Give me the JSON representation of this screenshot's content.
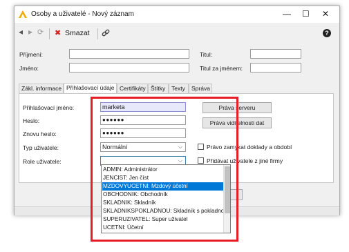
{
  "window": {
    "title": "Osoby a uživatelé - Nový záznam",
    "minimize": "—",
    "maximize": "☐",
    "close": "✕"
  },
  "toolbar": {
    "back_icon": "◂",
    "forward_icon": "▸",
    "refresh_icon": "⟳",
    "delete_icon": "✖",
    "delete_label": "Smazat",
    "link_icon": "🔗",
    "help_icon": "?"
  },
  "header_form": {
    "surname_label": "Příjmení:",
    "name_label": "Jméno:",
    "title_label": "Titul:",
    "title_after_label": "Titul za jménem:",
    "surname_value": "",
    "name_value": "",
    "title_value": "",
    "title_after_value": ""
  },
  "tabs": [
    {
      "label": "Zákl. informace",
      "active": false
    },
    {
      "label": "Přihlašovací údaje",
      "active": true
    },
    {
      "label": "Certifikáty",
      "active": false
    },
    {
      "label": "Štítky",
      "active": false
    },
    {
      "label": "Texty",
      "active": false
    },
    {
      "label": "Správa",
      "active": false
    }
  ],
  "login": {
    "login_label": "Přihlašovací jméno:",
    "login_value": "marketa",
    "password_label": "Heslo:",
    "password_value": "●●●●●●",
    "password2_label": "Znovu heslo:",
    "password2_value": "●●●●●●",
    "user_type_label": "Typ uživatele:",
    "user_type_value": "Normální",
    "role_label": "Role uživatele:",
    "role_value": ""
  },
  "buttons": {
    "server_rights": "Práva serveru",
    "visibility_rights": "Práva viditelnosti dat"
  },
  "checkboxes": {
    "lock_documents": "Právo zamykat doklady a období",
    "add_users_other_firm": "Přidávat uživatele z jiné firmy"
  },
  "dropdown_items": [
    {
      "label": "ADMIN: Administrátor",
      "selected": false
    },
    {
      "label": "JENCIST: Jen číst",
      "selected": false
    },
    {
      "label": "MZDOVYUCETNI: Mzdový účetní",
      "selected": true
    },
    {
      "label": "OBCHODNIK: Obchodník",
      "selected": false
    },
    {
      "label": "SKLADNIK: Skladník",
      "selected": false
    },
    {
      "label": "SKLADNIKSPOKLADNOU: Skladník s pokladnou",
      "selected": false
    },
    {
      "label": "SUPERUZIVATEL: Super uživatel",
      "selected": false
    },
    {
      "label": "UCETNI: Účetní",
      "selected": false
    }
  ],
  "colors": {
    "highlight": "#e81c24",
    "selection": "#0078d7",
    "login_field_bg": "#e8e8fb"
  }
}
